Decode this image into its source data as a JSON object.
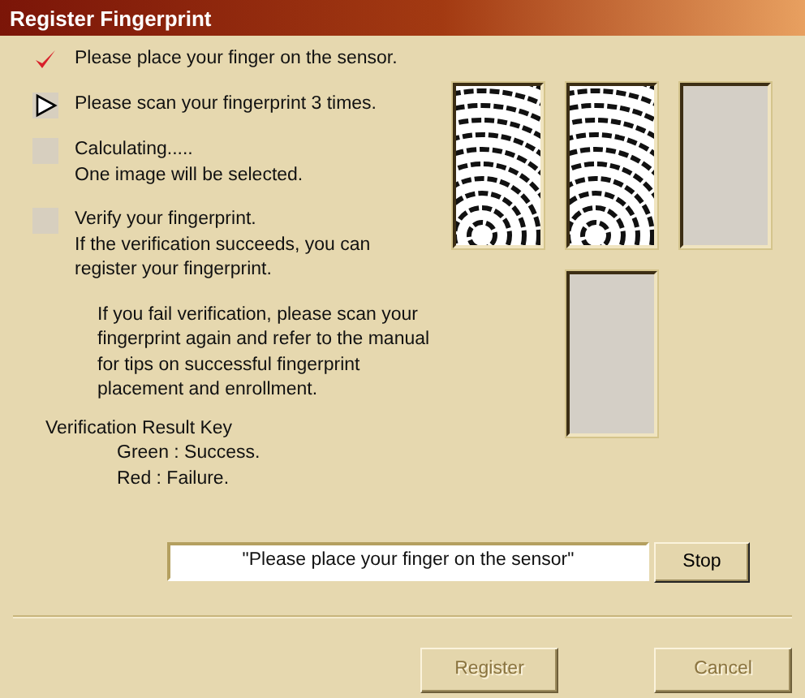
{
  "window": {
    "title": "Register Fingerprint"
  },
  "steps": [
    {
      "kind": "done",
      "lines": [
        "Please place your finger on the sensor."
      ]
    },
    {
      "kind": "current",
      "lines": [
        "Please scan your fingerprint 3 times."
      ]
    },
    {
      "kind": "pending",
      "lines": [
        "Calculating.....",
        "One image will be selected."
      ]
    },
    {
      "kind": "pending",
      "lines": [
        "Verify your fingerprint.",
        "If the verification succeeds, you can",
        "register your fingerprint."
      ]
    }
  ],
  "help_text": "If you fail verification, please scan your fingerprint again and refer to the manual for tips on successful fingerprint placement and enrollment.",
  "result_key": {
    "title": "Verification Result Key",
    "entries": [
      "Green : Success.",
      "Red : Failure."
    ]
  },
  "scan_images": [
    {
      "captured": true
    },
    {
      "captured": true
    },
    {
      "captured": false
    }
  ],
  "verify_image": {
    "captured": false
  },
  "status_field": {
    "value": "\"Please place your finger on the sensor\""
  },
  "buttons": [
    {
      "label": "Stop",
      "disabled": false
    },
    {
      "label": "Register",
      "disabled": true
    },
    {
      "label": "Cancel",
      "disabled": true
    }
  ]
}
